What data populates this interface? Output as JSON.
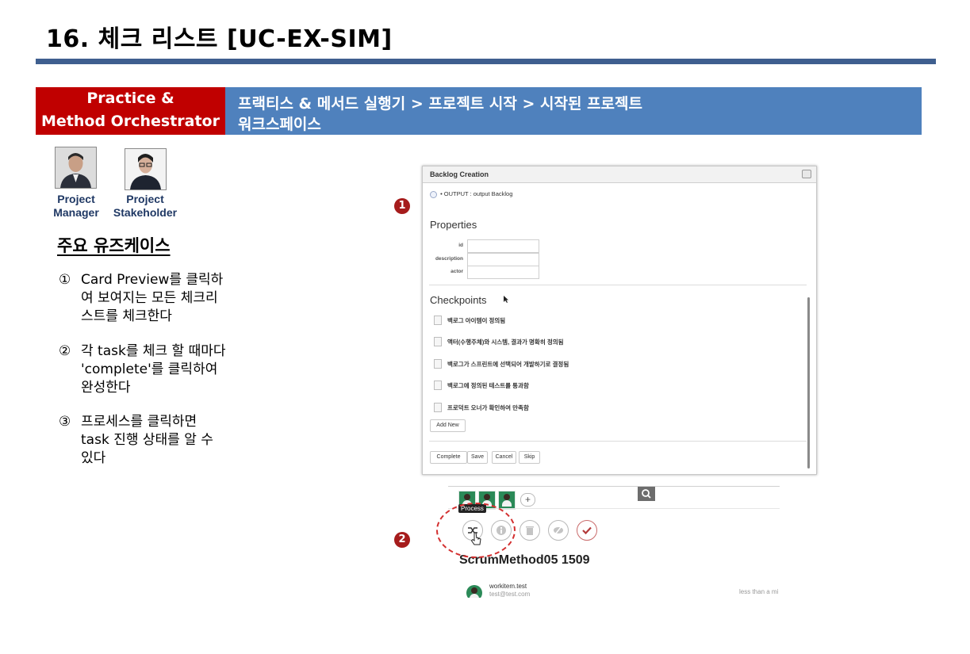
{
  "page": {
    "title": "16. 체크 리스트 [UC-EX-SIM]"
  },
  "header": {
    "left_line1": "Practice &",
    "left_line2": "Method Orchestrator",
    "right_line1": "프랙티스 & 메서드 실행기 > 프로젝트 시작 > 시작된 프로젝트",
    "right_line2": "워크스페이스"
  },
  "roles": [
    {
      "line1": "Project",
      "line2": "Manager"
    },
    {
      "line1": "Project",
      "line2": "Stakeholder"
    }
  ],
  "usecases": {
    "heading": "주요 유즈케이스",
    "items": [
      {
        "num": "①",
        "lines": [
          "Card Preview를 클릭하",
          "여 보여지는 모든 체크리",
          "스트를 체크한다"
        ]
      },
      {
        "num": "②",
        "lines": [
          "각 task를 체크 할 때마다",
          "'complete'를 클릭하여",
          "완성한다"
        ]
      },
      {
        "num": "③",
        "lines": [
          "프로세스를 클릭하면",
          "task 진행 상태를 알 수",
          "있다"
        ]
      }
    ]
  },
  "markers": {
    "m1": "1",
    "m2": "2"
  },
  "dialog": {
    "title": "Backlog Creation",
    "output": "• OUTPUT : output Backlog",
    "properties_heading": "Properties",
    "fields": [
      {
        "label": "id",
        "value": ""
      },
      {
        "label": "description",
        "value": ""
      },
      {
        "label": "actor",
        "value": ""
      }
    ],
    "checkpoints_heading": "Checkpoints",
    "checkpoints": [
      "백로그 아이템이 정의됨",
      "액터(수행주체)와 시스템, 결과가 명확히 정의됨",
      "백로그가 스프린트에 선택되어 개발하기로 결정됨",
      "백로그에 정의된 테스트를 통과함",
      "프로덕트 오너가 확인하여 만족함"
    ],
    "add_new": "Add New",
    "buttons": [
      "Complete",
      "Save",
      "Cancel",
      "Skip"
    ]
  },
  "process_view": {
    "tooltip": "Process",
    "title": "ScrumMethod05 1509",
    "add": "+",
    "user_name": "workitem.test",
    "user_email": "test@test.com",
    "time": "less than a mi",
    "icons": [
      "process-icon",
      "info-icon",
      "trash-icon",
      "hide-icon",
      "check-icon",
      "search-icon"
    ]
  }
}
